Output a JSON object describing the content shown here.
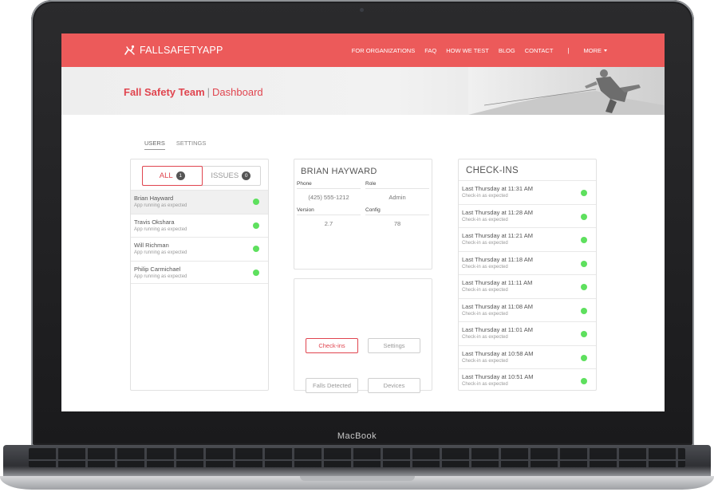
{
  "device": {
    "brand": "MacBook"
  },
  "navbar": {
    "logo_text": "FALLSAFETYAPP",
    "links": [
      "FOR ORGANIZATIONS",
      "FAQ",
      "HOW WE TEST",
      "BLOG",
      "CONTACT"
    ],
    "separator": "|",
    "more_label": "MORE"
  },
  "hero": {
    "team": "Fall Safety Team",
    "separator": "|",
    "page": "Dashboard"
  },
  "tabs": [
    "USERS",
    "SETTINGS"
  ],
  "users_panel": {
    "filters": [
      {
        "label": "ALL",
        "count": "1"
      },
      {
        "label": "ISSUES",
        "count": "0"
      }
    ],
    "users": [
      {
        "name": "Brian Hayward",
        "status": "App running as expected"
      },
      {
        "name": "Travis Okshara",
        "status": "App running as expected"
      },
      {
        "name": "Will Richman",
        "status": "App running as expected"
      },
      {
        "name": "Philip Carmichael",
        "status": "App running as expected"
      }
    ]
  },
  "user_detail": {
    "name": "BRIAN HAYWARD",
    "fields": [
      {
        "label": "Phone",
        "value": "(425) 555-1212"
      },
      {
        "label": "Role",
        "value": "Admin"
      },
      {
        "label": "Version",
        "value": "2.7"
      },
      {
        "label": "Config",
        "value": "78"
      }
    ]
  },
  "actions": {
    "checkins": "Check-ins",
    "settings": "Settings",
    "falls": "Falls Detected",
    "devices": "Devices"
  },
  "checkins": {
    "title": "CHECK-INS",
    "items": [
      {
        "time": "Last Thursday at 11:31 AM",
        "status": "Check-in as expected"
      },
      {
        "time": "Last Thursday at 11:28 AM",
        "status": "Check-in as expected"
      },
      {
        "time": "Last Thursday at 11:21 AM",
        "status": "Check-in as expected"
      },
      {
        "time": "Last Thursday at 11:18 AM",
        "status": "Check-in as expected"
      },
      {
        "time": "Last Thursday at 11:11 AM",
        "status": "Check-in as expected"
      },
      {
        "time": "Last Thursday at 11:08 AM",
        "status": "Check-in as expected"
      },
      {
        "time": "Last Thursday at 11:01 AM",
        "status": "Check-in as expected"
      },
      {
        "time": "Last Thursday at 10:58 AM",
        "status": "Check-in as expected"
      },
      {
        "time": "Last Thursday at 10:51 AM",
        "status": "Check-in as expected"
      }
    ]
  },
  "colors": {
    "accent": "#ec5a5a",
    "status_ok": "#5ee05e"
  },
  "icons": {
    "logo": "fall-safety-logo-icon",
    "more": "caret-down-icon",
    "status": "status-dot-icon"
  }
}
